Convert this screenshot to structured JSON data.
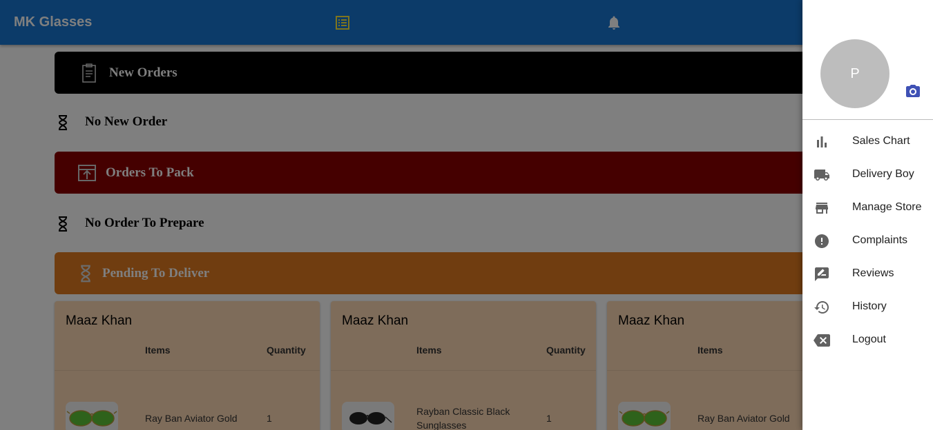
{
  "app": {
    "title": "MK Glasses"
  },
  "sections": {
    "new_orders": {
      "title": "New Orders",
      "color": "#000000",
      "empty_text": "No New Order"
    },
    "orders_to_pack": {
      "title": "Orders To Pack",
      "color": "#8b0000",
      "empty_text": "No Order To Prepare"
    },
    "pending_to_deliver": {
      "title": "Pending To Deliver",
      "color": "#e07b21",
      "card_color": "#fcd8b4"
    }
  },
  "orders": [
    {
      "customer": "Maaz Khan",
      "items_header": "Items",
      "quantity_header": "Quantity",
      "item_name": "Ray Ban Aviator Gold",
      "quantity": "1",
      "image_icon": "aviator-gold-sunglasses"
    },
    {
      "customer": "Maaz Khan",
      "items_header": "Items",
      "quantity_header": "Quantity",
      "item_name": "Rayban Classic Black Sunglasses",
      "quantity": "1",
      "image_icon": "classic-black-sunglasses"
    },
    {
      "customer": "Maaz Khan",
      "items_header": "Items",
      "quantity_header": "",
      "item_name": "Ray Ban Aviator Gold",
      "quantity": "",
      "image_icon": "aviator-gold-sunglasses"
    }
  ],
  "drawer": {
    "avatar_initial": "P",
    "menu": [
      {
        "label": "Sales Chart",
        "icon": "bar-chart-icon"
      },
      {
        "label": "Delivery Boy",
        "icon": "truck-icon"
      },
      {
        "label": "Manage Store",
        "icon": "store-icon"
      },
      {
        "label": "Complaints",
        "icon": "alert-icon"
      },
      {
        "label": "Reviews",
        "icon": "rate-review-icon"
      },
      {
        "label": "History",
        "icon": "history-icon"
      },
      {
        "label": "Logout",
        "icon": "backspace-icon"
      }
    ]
  },
  "colors": {
    "appbar": "#1976d2",
    "accent": "#3f51b5"
  }
}
